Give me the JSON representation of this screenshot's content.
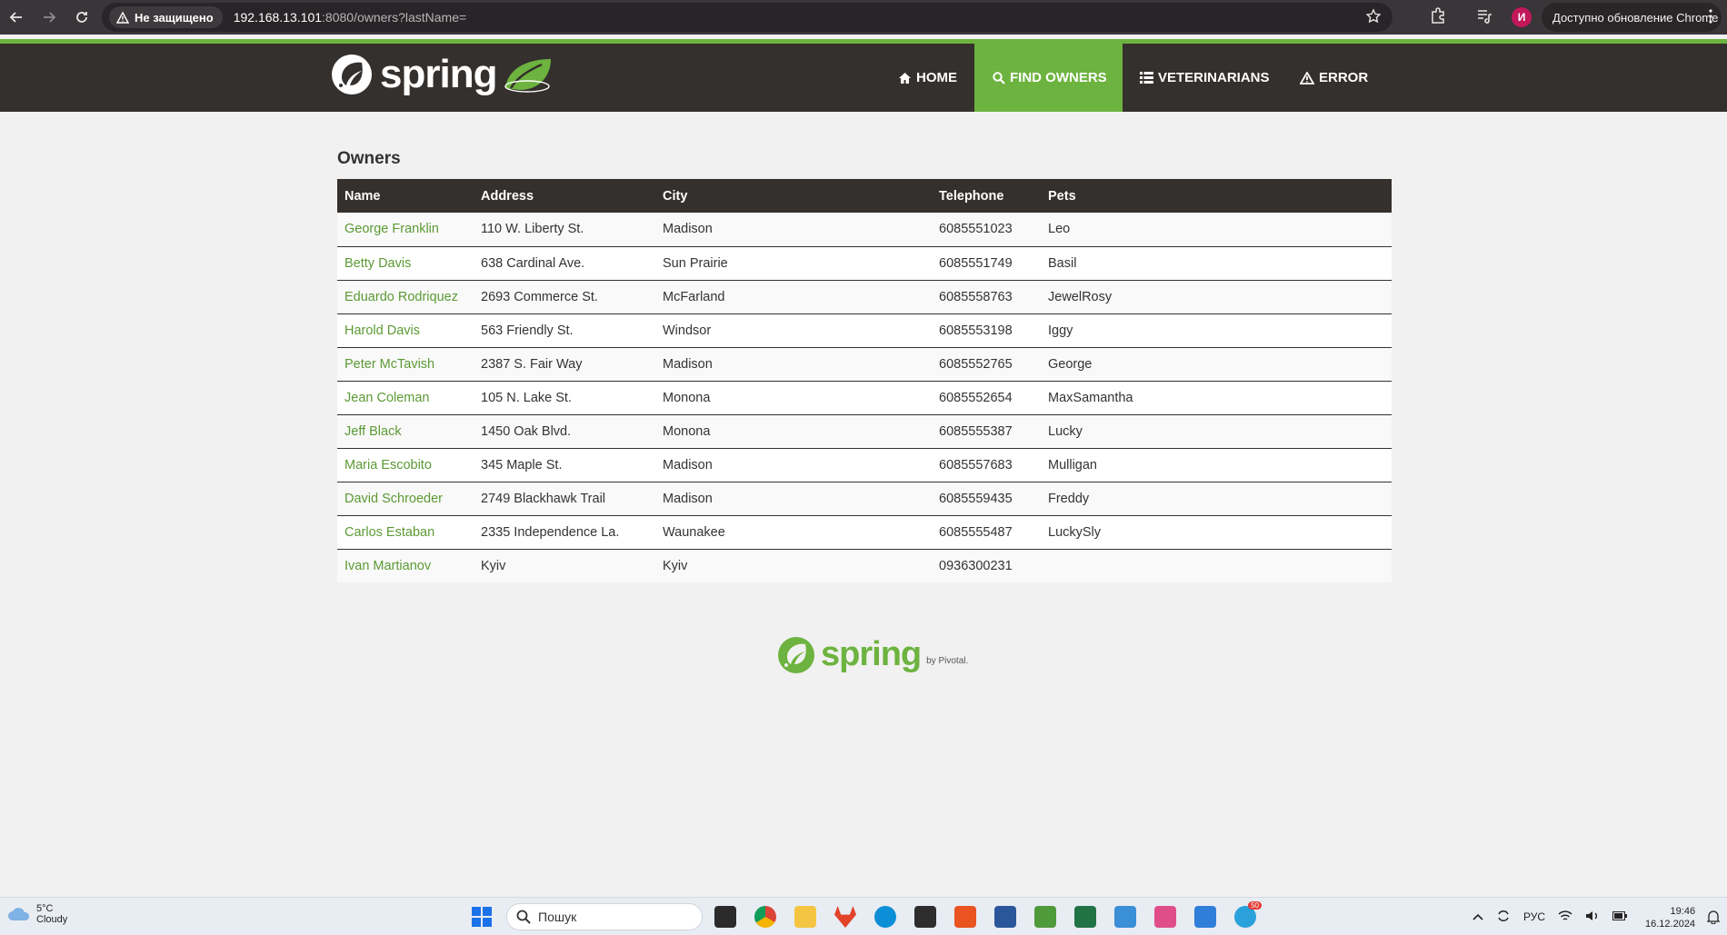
{
  "browser": {
    "security_label": "Не защищено",
    "url_host": "192.168.13.101",
    "url_rest": ":8080/owners?lastName=",
    "profile_initial": "И",
    "update_label": "Доступно обновление Chrome"
  },
  "navbar": {
    "brand": "spring",
    "items": [
      {
        "label": "Home",
        "icon": "home-icon"
      },
      {
        "label": "Find owners",
        "icon": "search-icon"
      },
      {
        "label": "Veterinarians",
        "icon": "list-icon"
      },
      {
        "label": "Error",
        "icon": "warning-icon"
      }
    ],
    "active_item": "Find owners"
  },
  "page": {
    "title": "Owners",
    "columns": [
      "Name",
      "Address",
      "City",
      "Telephone",
      "Pets"
    ],
    "owners": [
      {
        "name": "George Franklin",
        "address": "110 W. Liberty St.",
        "city": "Madison",
        "telephone": "6085551023",
        "pets": "Leo"
      },
      {
        "name": "Betty Davis",
        "address": "638 Cardinal Ave.",
        "city": "Sun Prairie",
        "telephone": "6085551749",
        "pets": "Basil"
      },
      {
        "name": "Eduardo Rodriquez",
        "address": "2693 Commerce St.",
        "city": "McFarland",
        "telephone": "6085558763",
        "pets": "JewelRosy"
      },
      {
        "name": "Harold Davis",
        "address": "563 Friendly St.",
        "city": "Windsor",
        "telephone": "6085553198",
        "pets": "Iggy"
      },
      {
        "name": "Peter McTavish",
        "address": "2387 S. Fair Way",
        "city": "Madison",
        "telephone": "6085552765",
        "pets": "George"
      },
      {
        "name": "Jean Coleman",
        "address": "105 N. Lake St.",
        "city": "Monona",
        "telephone": "6085552654",
        "pets": "MaxSamantha"
      },
      {
        "name": "Jeff Black",
        "address": "1450 Oak Blvd.",
        "city": "Monona",
        "telephone": "6085555387",
        "pets": "Lucky"
      },
      {
        "name": "Maria Escobito",
        "address": "345 Maple St.",
        "city": "Madison",
        "telephone": "6085557683",
        "pets": "Mulligan"
      },
      {
        "name": "David Schroeder",
        "address": "2749 Blackhawk Trail",
        "city": "Madison",
        "telephone": "6085559435",
        "pets": "Freddy"
      },
      {
        "name": "Carlos Estaban",
        "address": "2335 Independence La.",
        "city": "Waunakee",
        "telephone": "6085555487",
        "pets": "LuckySly"
      },
      {
        "name": "Ivan Martianov",
        "address": "Kyiv",
        "city": "Kyiv",
        "telephone": "0936300231",
        "pets": ""
      }
    ]
  },
  "footer": {
    "brand": "spring",
    "by": "by Pivotal."
  },
  "taskbar": {
    "weather_temp": "5°C",
    "weather_desc": "Cloudy",
    "search_placeholder": "Пошук",
    "language": "РУС",
    "time": "19:46",
    "date": "16.12.2024",
    "telegram_badge": "50"
  },
  "colors": {
    "spring_green": "#6db33f",
    "navbar_bg": "#34302d",
    "link_green": "#5c9a34"
  }
}
